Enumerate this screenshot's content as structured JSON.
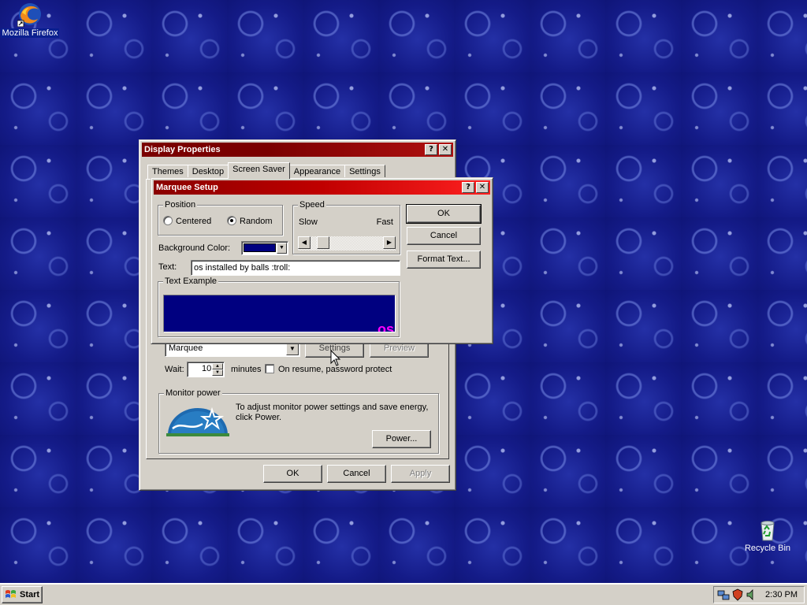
{
  "desktop": {
    "icons": [
      {
        "label": "Mozilla Firefox"
      },
      {
        "label": "Recycle Bin"
      }
    ]
  },
  "display_properties": {
    "title": "Display Properties",
    "tabs": [
      "Themes",
      "Desktop",
      "Screen Saver",
      "Appearance",
      "Settings"
    ],
    "selected_tab": "Screen Saver",
    "screensaver_value": "Marquee",
    "settings_label": "Settings",
    "preview_label": "Preview",
    "wait_label": "Wait:",
    "wait_value": "10",
    "minutes_label": "minutes",
    "resume_label": "On resume, password protect",
    "monitor_power_legend": "Monitor power",
    "monitor_power_text": "To adjust monitor power settings and save energy, click Power.",
    "power_label": "Power...",
    "ok_label": "OK",
    "cancel_label": "Cancel",
    "apply_label": "Apply"
  },
  "marquee_setup": {
    "title": "Marquee Setup",
    "position_legend": "Position",
    "centered_label": "Centered",
    "random_label": "Random",
    "position_selected": "Random",
    "speed_legend": "Speed",
    "slow_label": "Slow",
    "fast_label": "Fast",
    "speed_level": 0.2,
    "background_color_label": "Background Color:",
    "background_color": "#000080",
    "text_label": "Text:",
    "text_value": "os installed by balls :troll:",
    "text_example_legend": "Text Example",
    "preview_text": "os",
    "preview_text_color": "#ff00ff",
    "ok_label": "OK",
    "cancel_label": "Cancel",
    "format_text_label": "Format Text..."
  },
  "taskbar": {
    "start_label": "Start",
    "clock": "2:30 PM"
  }
}
